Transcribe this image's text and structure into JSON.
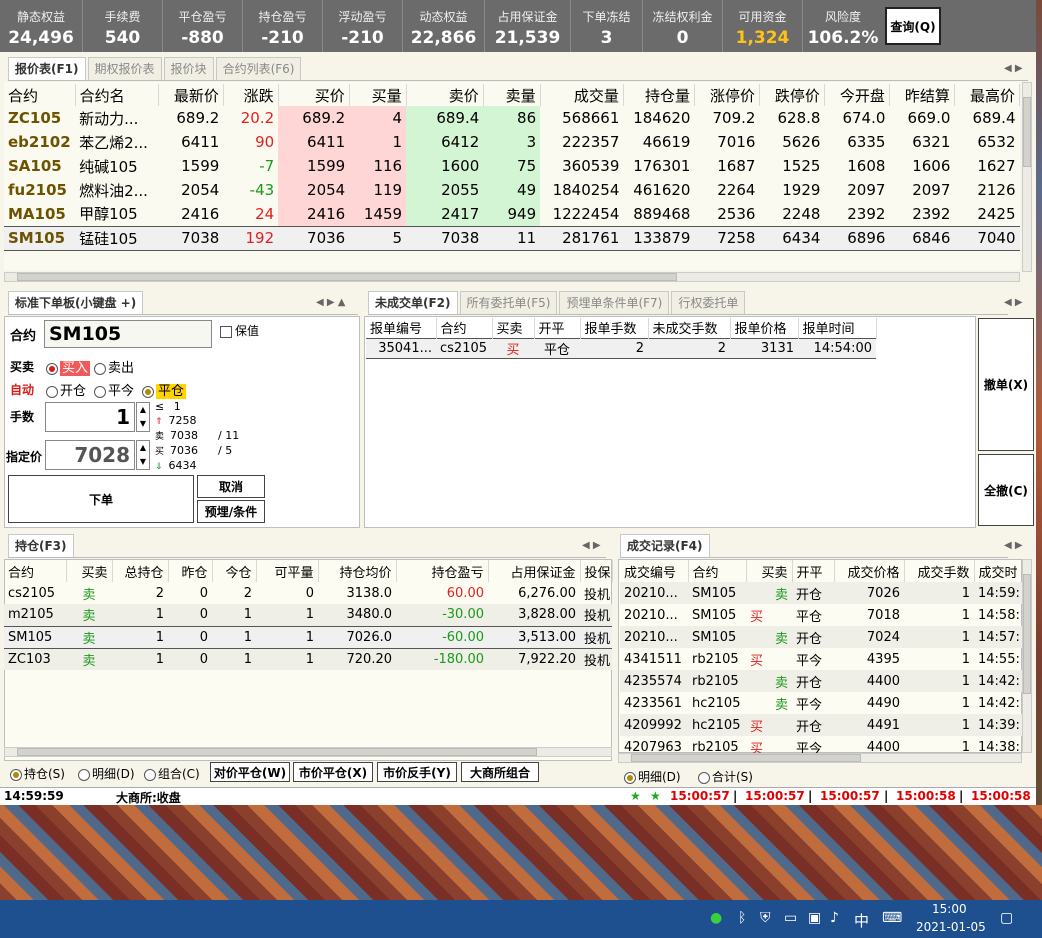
{
  "stats": [
    {
      "label": "静态权益",
      "value": "24,496"
    },
    {
      "label": "手续费",
      "value": "540"
    },
    {
      "label": "平仓盈亏",
      "value": "-880"
    },
    {
      "label": "持仓盈亏",
      "value": "-210"
    },
    {
      "label": "浮动盈亏",
      "value": "-210"
    },
    {
      "label": "动态权益",
      "value": "22,866"
    },
    {
      "label": "占用保证金",
      "value": "21,539"
    },
    {
      "label": "下单冻结",
      "value": "3"
    },
    {
      "label": "冻结权利金",
      "value": "0"
    },
    {
      "label": "可用资金",
      "value": "1,324"
    },
    {
      "label": "风险度",
      "value": "106.2%"
    }
  ],
  "query_button": "查询(Q)",
  "quote_tabs": [
    "报价表(F1)",
    "期权报价表",
    "报价块",
    "合约列表(F6)"
  ],
  "quote_headers": [
    "合约",
    "合约名",
    "最新价",
    "涨跌",
    "买价",
    "买量",
    "卖价",
    "卖量",
    "成交量",
    "持仓量",
    "涨停价",
    "跌停价",
    "今开盘",
    "昨结算",
    "最高价"
  ],
  "quotes": [
    {
      "sym": "ZC105",
      "name": "新动力...",
      "last": "689.2",
      "chg": "20.2",
      "bid": "689.2",
      "bidv": "4",
      "ask": "689.4",
      "askv": "86",
      "vol": "568661",
      "oi": "184620",
      "up": "709.2",
      "down": "628.8",
      "open": "674.0",
      "prev": "669.0",
      "high": "689.4"
    },
    {
      "sym": "eb2102",
      "name": "苯乙烯2...",
      "last": "6411",
      "chg": "90",
      "bid": "6411",
      "bidv": "1",
      "ask": "6412",
      "askv": "3",
      "vol": "222357",
      "oi": "46619",
      "up": "7016",
      "down": "5626",
      "open": "6335",
      "prev": "6321",
      "high": "6532"
    },
    {
      "sym": "SA105",
      "name": "纯碱105",
      "last": "1599",
      "chg": "-7",
      "bid": "1599",
      "bidv": "116",
      "ask": "1600",
      "askv": "75",
      "vol": "360539",
      "oi": "176301",
      "up": "1687",
      "down": "1525",
      "open": "1608",
      "prev": "1606",
      "high": "1627"
    },
    {
      "sym": "fu2105",
      "name": "燃料油2...",
      "last": "2054",
      "chg": "-43",
      "bid": "2054",
      "bidv": "119",
      "ask": "2055",
      "askv": "49",
      "vol": "1840254",
      "oi": "461620",
      "up": "2264",
      "down": "1929",
      "open": "2097",
      "prev": "2097",
      "high": "2126"
    },
    {
      "sym": "MA105",
      "name": "甲醇105",
      "last": "2416",
      "chg": "24",
      "bid": "2416",
      "bidv": "1459",
      "ask": "2417",
      "askv": "949",
      "vol": "1222454",
      "oi": "889468",
      "up": "2536",
      "down": "2248",
      "open": "2392",
      "prev": "2392",
      "high": "2425"
    },
    {
      "sym": "SM105",
      "name": "锰硅105",
      "last": "7038",
      "chg": "192",
      "bid": "7036",
      "bidv": "5",
      "ask": "7038",
      "askv": "11",
      "vol": "281761",
      "oi": "133879",
      "up": "7258",
      "down": "6434",
      "open": "6896",
      "prev": "6846",
      "high": "7040"
    }
  ],
  "order_panel": {
    "tab": "标准下单板(小键盘 +)",
    "contract_label": "合约",
    "contract_value": "SM105",
    "keep_label": "保值",
    "side_label": "买卖",
    "buy": "买入",
    "sell": "卖出",
    "auto_label": "自动",
    "open": "开仓",
    "close_today": "平今",
    "close": "平仓",
    "qty_label": "手数",
    "qty_value": "1",
    "price_label": "指定价",
    "price_value": "7028",
    "le": "≤",
    "le_val": "1",
    "limit_up": "7258",
    "ask_price": "7038",
    "ask_qty": "11",
    "bid_price": "7036",
    "bid_qty": "5",
    "limit_down": "6434",
    "sell_tag": "卖",
    "buy_tag": "买",
    "slash": "/",
    "place": "下单",
    "cancel": "取消",
    "preset": "预埋/条件"
  },
  "pending_tabs": [
    "未成交单(F2)",
    "所有委托单(F5)",
    "预埋单条件单(F7)",
    "行权委托单"
  ],
  "pending_headers": [
    "报单编号",
    "合约",
    "买卖",
    "开平",
    "报单手数",
    "未成交手数",
    "报单价格",
    "报单时间"
  ],
  "pending": [
    {
      "id": "35041...",
      "sym": "cs2105",
      "side": "买",
      "oc": "平仓",
      "qty": "2",
      "left": "2",
      "price": "3131",
      "time": "14:54:00"
    }
  ],
  "cancel_btn": "撤单(X)",
  "cancel_all_btn": "全撤(C)",
  "pos_tab": "持仓(F3)",
  "pos_headers": [
    "合约",
    "买卖",
    "总持仓",
    "昨仓",
    "今仓",
    "可平量",
    "持仓均价",
    "持仓盈亏",
    "占用保证金",
    "投保"
  ],
  "positions": [
    {
      "sym": "cs2105",
      "side": "卖",
      "total": "2",
      "yd": "0",
      "td": "2",
      "avail": "0",
      "avg": "3138.0",
      "pnl": "60.00",
      "margin": "6,276.00",
      "type": "投机"
    },
    {
      "sym": "m2105",
      "side": "卖",
      "total": "1",
      "yd": "0",
      "td": "1",
      "avail": "1",
      "avg": "3480.0",
      "pnl": "-30.00",
      "margin": "3,828.00",
      "type": "投机"
    },
    {
      "sym": "SM105",
      "side": "卖",
      "total": "1",
      "yd": "0",
      "td": "1",
      "avail": "1",
      "avg": "7026.0",
      "pnl": "-60.00",
      "margin": "3,513.00",
      "type": "投机"
    },
    {
      "sym": "ZC103",
      "side": "卖",
      "total": "1",
      "yd": "0",
      "td": "1",
      "avail": "1",
      "avg": "720.20",
      "pnl": "-180.00",
      "margin": "7,922.20",
      "type": "投机"
    }
  ],
  "pos_bottom": {
    "r1": "持仓(S)",
    "r2": "明细(D)",
    "r3": "组合(C)",
    "b1": "对价平仓(W)",
    "b2": "市价平仓(X)",
    "b3": "市价反手(Y)",
    "b4": "大商所组合"
  },
  "trade_tab": "成交记录(F4)",
  "trade_headers": [
    "成交编号",
    "合约",
    "买卖",
    "开平",
    "成交价格",
    "成交手数",
    "成交时"
  ],
  "trades": [
    {
      "id": "20210...",
      "sym": "SM105",
      "side": "卖",
      "oc": "开仓",
      "price": "7026",
      "qty": "1",
      "time": "14:59:"
    },
    {
      "id": "20210...",
      "sym": "SM105",
      "side": "买",
      "oc": "平仓",
      "price": "7018",
      "qty": "1",
      "time": "14:58:"
    },
    {
      "id": "20210...",
      "sym": "SM105",
      "side": "卖",
      "oc": "开仓",
      "price": "7024",
      "qty": "1",
      "time": "14:57:"
    },
    {
      "id": "4341511",
      "sym": "rb2105",
      "side": "买",
      "oc": "平今",
      "price": "4395",
      "qty": "1",
      "time": "14:55:"
    },
    {
      "id": "4235574",
      "sym": "rb2105",
      "side": "卖",
      "oc": "开仓",
      "price": "4400",
      "qty": "1",
      "time": "14:42:"
    },
    {
      "id": "4233561",
      "sym": "hc2105",
      "side": "卖",
      "oc": "平今",
      "price": "4490",
      "qty": "1",
      "time": "14:42:"
    },
    {
      "id": "4209992",
      "sym": "hc2105",
      "side": "买",
      "oc": "开仓",
      "price": "4491",
      "qty": "1",
      "time": "14:39:"
    },
    {
      "id": "4207963",
      "sym": "rb2105",
      "side": "买",
      "oc": "平今",
      "price": "4400",
      "qty": "1",
      "time": "14:38:"
    }
  ],
  "trade_bottom": {
    "r1": "明细(D)",
    "r2": "合计(S)"
  },
  "status": {
    "time": "14:59:59",
    "exchange": "大商所:收盘",
    "clocks": [
      "15:00:57",
      "15:00:57",
      "15:00:57",
      "15:00:58",
      "15:00:58"
    ],
    "sep": "|",
    "star": "★"
  },
  "taskbar": {
    "ime": "中",
    "time": "15:00",
    "date": "2021-01-05"
  }
}
